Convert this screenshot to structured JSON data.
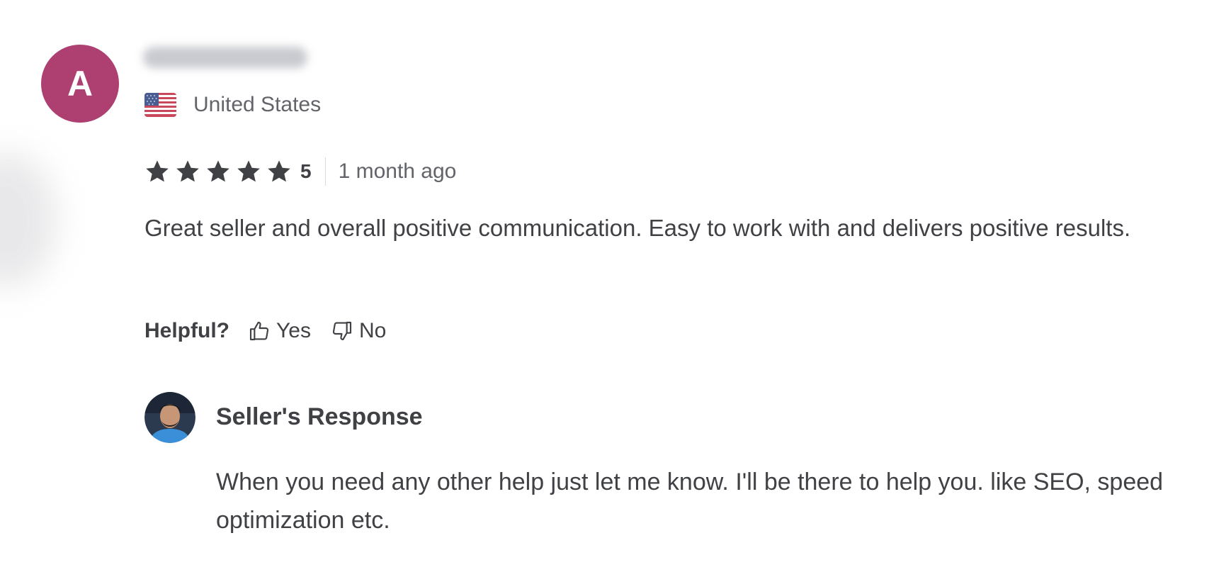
{
  "review": {
    "avatar_initial": "A",
    "avatar_color": "#ad3f71",
    "username_blurred": true,
    "country": "United States",
    "flag_icon": "us-flag-icon",
    "rating": {
      "stars": 5,
      "value": "5",
      "star_icon": "star-icon",
      "star_color": "#404145"
    },
    "time_ago": "1 month ago",
    "text": "Great seller and overall positive communication. Easy to work with and delivers positive results."
  },
  "helpful": {
    "label": "Helpful?",
    "yes_label": "Yes",
    "no_label": "No",
    "yes_icon": "thumbs-up-icon",
    "no_icon": "thumbs-down-icon"
  },
  "seller_response": {
    "title": "Seller's Response",
    "text": "When you need any other help just let me know. I'll be there to help you. like SEO, speed optimization etc."
  }
}
